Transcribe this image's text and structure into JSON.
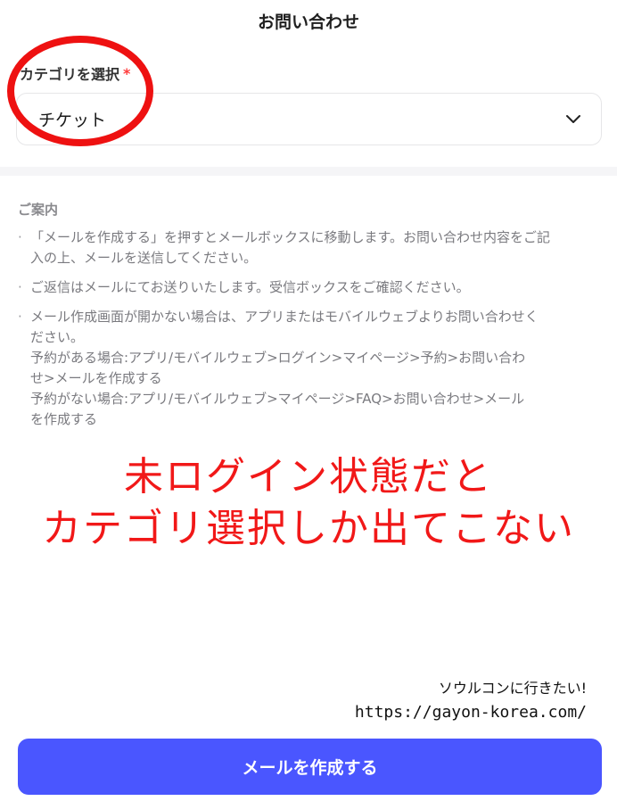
{
  "header": {
    "title": "お問い合わせ"
  },
  "category": {
    "label": "カテゴリを選択",
    "required_mark": "*",
    "selected_value": "チケット",
    "icon": "chevron-down-icon"
  },
  "notice": {
    "title": "ご案内",
    "items": [
      [
        "「メールを作成する」を押すとメールボックスに移動します。お問い合わせ内容をご記",
        "入の上、メールを送信してください。"
      ],
      [
        "ご返信はメールにてお送りいたします。受信ボックスをご確認ください。"
      ],
      [
        "メール作成画面が開かない場合は、アプリまたはモバイルウェブよりお問い合わせく",
        "ださい。",
        "予約がある場合:アプリ/モバイルウェブ>ログイン>マイページ>予約>お問い合わ",
        "せ>メールを作成する",
        "予約がない場合:アプリ/モバイルウェブ>マイページ>FAQ>お問い合わせ>メール",
        "を作成する"
      ]
    ]
  },
  "overlay": {
    "line1": "未ログイン状態だと",
    "line2": "カテゴリ選択しか出てこない",
    "color": "#f11818"
  },
  "watermark": {
    "line1": "ソウルコンに行きたい!",
    "line2": "https://gayon-korea.com/"
  },
  "cta": {
    "label": "メールを作成する",
    "color": "#4a56ff"
  },
  "annotation": {
    "shape": "red-circle",
    "color": "#ee1111"
  }
}
